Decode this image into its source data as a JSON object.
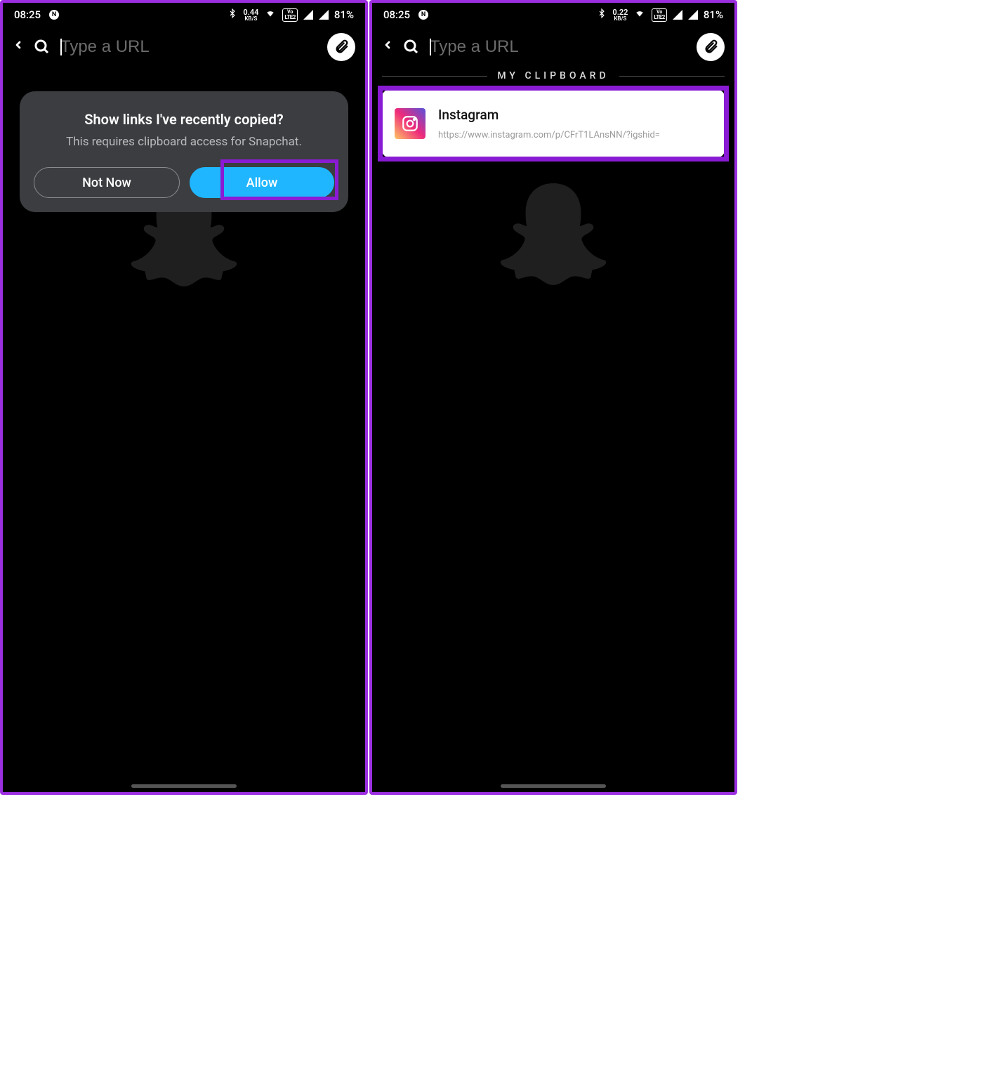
{
  "status": {
    "time": "08:25",
    "battery": "81%",
    "left_kbs": "0.44",
    "right_kbs": "0.22",
    "kbs_unit": "KB/S",
    "lte_top": "Vo",
    "lte_bot": "LTE2"
  },
  "search": {
    "placeholder": "Type a URL"
  },
  "modal": {
    "title": "Show links I've recently copied?",
    "subtitle": "This requires clipboard access for Snapchat.",
    "not_now": "Not Now",
    "allow": "Allow"
  },
  "clipboard": {
    "header": "MY CLIPBOARD",
    "card": {
      "title": "Instagram",
      "url": "https://www.instagram.com/p/CFrT1LAnsNN/?igshid="
    }
  }
}
